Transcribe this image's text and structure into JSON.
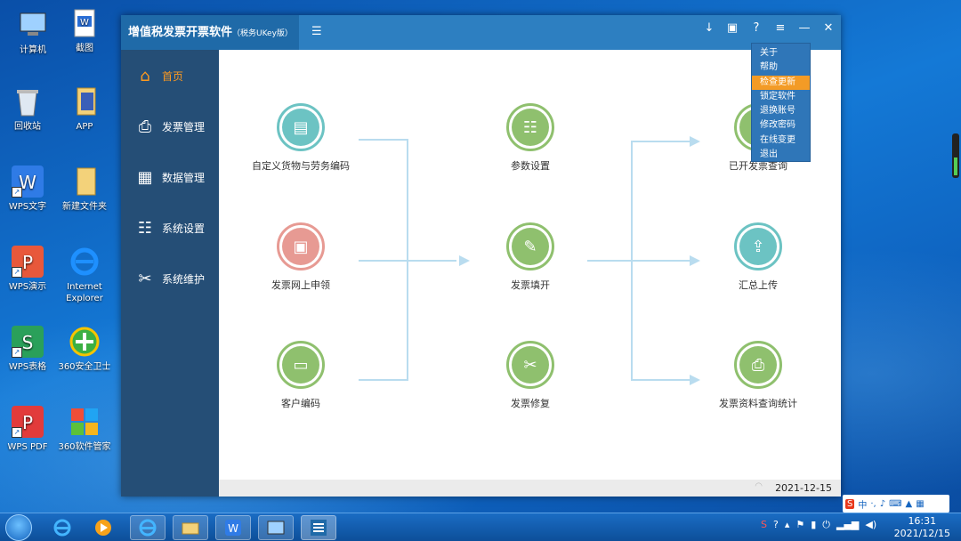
{
  "desktop": {
    "icons": [
      {
        "label": "计算机",
        "icon": "computer-icon"
      },
      {
        "label": "截图",
        "icon": "word-doc-icon"
      },
      {
        "label": "回收站",
        "icon": "recycle-bin-icon"
      },
      {
        "label": "APP",
        "icon": "folder-icon"
      },
      {
        "label": "WPS文字",
        "icon": "wps-writer-icon"
      },
      {
        "label": "新建文件夹",
        "icon": "folder-icon"
      },
      {
        "label": "WPS演示",
        "icon": "wps-presentation-icon"
      },
      {
        "label": "Internet Explorer",
        "icon": "ie-icon"
      },
      {
        "label": "WPS表格",
        "icon": "wps-spreadsheet-icon"
      },
      {
        "label": "360安全卫士",
        "icon": "360-safe-icon"
      },
      {
        "label": "WPS PDF",
        "icon": "wps-pdf-icon"
      },
      {
        "label": "360软件管家",
        "icon": "360-software-icon"
      }
    ]
  },
  "window": {
    "title": "增值税发票开票软件",
    "title_suffix": "（税务UKey版）",
    "title_buttons": [
      "download-icon",
      "skin-icon",
      "help-icon",
      "menu-icon",
      "minimize-icon",
      "close-icon"
    ],
    "title_button_text": [
      "↓",
      "▣",
      "?",
      "≡",
      "—",
      "✕"
    ],
    "sidebar": [
      {
        "label": "首页",
        "icon": "home-icon",
        "active": true
      },
      {
        "label": "发票管理",
        "icon": "printer-icon",
        "active": false
      },
      {
        "label": "数据管理",
        "icon": "data-icon",
        "active": false
      },
      {
        "label": "系统设置",
        "icon": "settings-icon",
        "active": false
      },
      {
        "label": "系统维护",
        "icon": "tools-icon",
        "active": false
      }
    ],
    "nodes": {
      "custom_goods": "自定义货物与劳务编码",
      "invoice_apply": "发票网上申领",
      "customer_code": "客户编码",
      "params": "参数设置",
      "invoice_fill": "发票填开",
      "invoice_repair": "发票修复",
      "issued_query": "已开发票查询",
      "summary_upload": "汇总上传",
      "stats_query": "发票资料查询统计"
    },
    "status_date": "2021-12-15"
  },
  "menu": {
    "items": [
      "关于",
      "帮助",
      "检查更新",
      "锁定软件",
      "退换账号",
      "修改密码",
      "在线变更",
      "退出"
    ],
    "highlighted": "检查更新"
  },
  "taskbar": {
    "clock_time": "16:31",
    "clock_date": "2021/12/15",
    "ime_label": "中"
  },
  "colors": {
    "accent": "#2d7fc1",
    "sidebar": "#254e76",
    "active": "#ff9a1f",
    "menu_highlight": "#f39b26"
  }
}
